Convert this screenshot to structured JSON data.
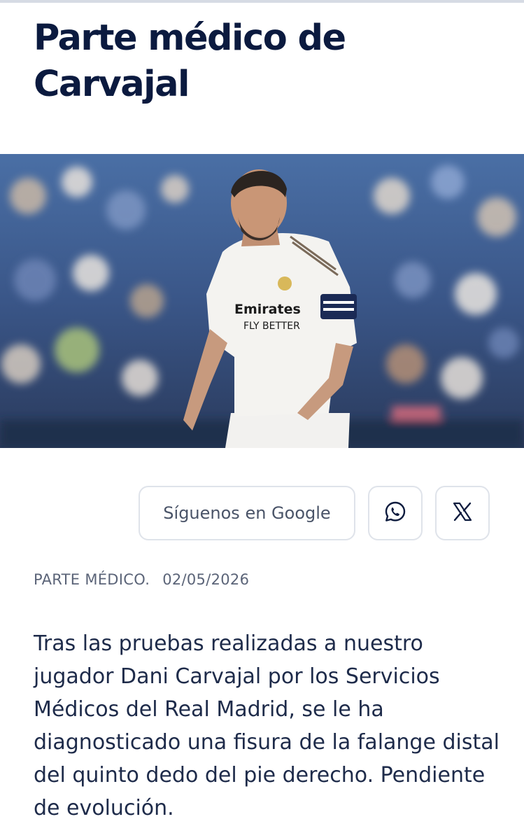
{
  "article": {
    "title": "Parte médico de Carvajal",
    "hero_image": "player-photo",
    "share": {
      "google_label": "Síguenos en Google",
      "whatsapp_icon": "whatsapp-icon",
      "x_icon": "x-icon"
    },
    "category": "PARTE MÉDICO.",
    "date": "02/05/2026",
    "body": "Tras las pruebas realizadas a nuestro jugador Dani Carvajal por los Servicios Médicos del Real Madrid, se le ha diagnosticado una fisura de la falange distal del quinto dedo del pie derecho. Pendiente de evolución."
  },
  "colors": {
    "title": "#0b1a3f",
    "text": "#1e2b4a",
    "meta": "#5b6478",
    "border": "#dfe3ea"
  }
}
